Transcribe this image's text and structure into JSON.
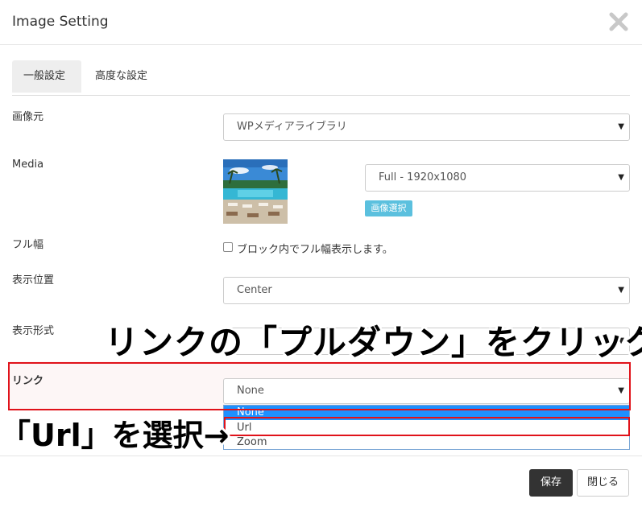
{
  "dialog": {
    "title": "Image Setting"
  },
  "tabs": [
    {
      "label": "一般設定",
      "active": true
    },
    {
      "label": "高度な設定",
      "active": false
    }
  ],
  "fields": {
    "source": {
      "label": "画像元",
      "value": "WPメディアライブラリ"
    },
    "media": {
      "label": "Media",
      "size_value": "Full - 1920x1080",
      "select_button": "画像選択"
    },
    "full_width": {
      "label": "フル幅",
      "checkbox_label": "ブロック内でフル幅表示します。",
      "checked": false
    },
    "position": {
      "label": "表示位置",
      "value": "Center"
    },
    "display_format": {
      "label": "表示形式"
    },
    "link": {
      "label": "リンク",
      "value": "None",
      "options": [
        "None",
        "Url",
        "Zoom"
      ],
      "highlighted": "None"
    }
  },
  "annotations": {
    "instruction_1": "リンクの「プルダウン」をクリック",
    "instruction_2": "「Url」を選択→"
  },
  "footer": {
    "save_label": "保存",
    "close_label": "閉じる"
  },
  "colors": {
    "accent_info": "#5bc0de",
    "highlight_red": "#e0121a",
    "option_highlight": "#1e90ff",
    "save_bg": "#333333"
  }
}
